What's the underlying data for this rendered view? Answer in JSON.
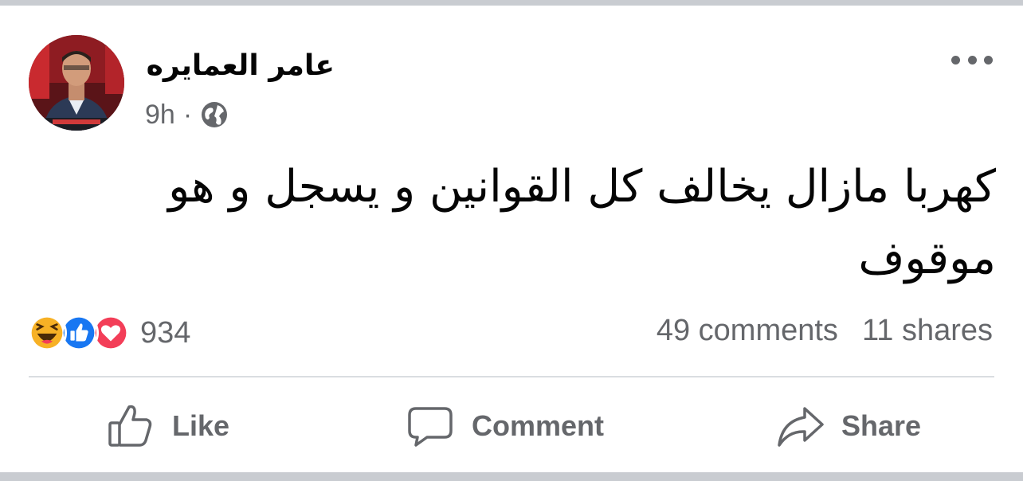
{
  "post": {
    "author_name": "عامر العمايره",
    "timestamp": "9h",
    "separator": "·",
    "audience_icon": "globe-icon",
    "more_icon": "more-options-icon",
    "text": "كهربا مازال يخالف كل القوانين و يسجل و هو موقوف"
  },
  "engagement": {
    "reaction_icons": [
      "haha-reaction-icon",
      "like-reaction-icon",
      "love-reaction-icon"
    ],
    "reaction_count": "934",
    "comments": "49 comments",
    "shares": "11 shares"
  },
  "actions": {
    "like_label": "Like",
    "comment_label": "Comment",
    "share_label": "Share"
  },
  "colors": {
    "secondary_text": "#65676b",
    "like_blue": "#1877f2",
    "love_red": "#f33e58",
    "haha_yellow": "#f7b125",
    "divider": "#dadde1",
    "frame_gray": "#c9ccd1"
  }
}
